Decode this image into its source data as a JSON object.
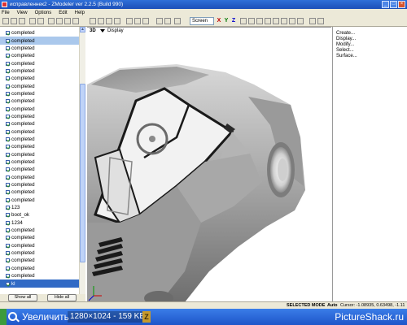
{
  "window": {
    "title": "исправленнек2 - ZModeler ver 2.2.5 (Build 990)"
  },
  "menu": [
    "File",
    "View",
    "Options",
    "Edit",
    "Help"
  ],
  "toolbar": {
    "snap_select": "Screen",
    "axes": [
      "X",
      "Y",
      "Z"
    ]
  },
  "sidebar": {
    "items": [
      {
        "label": "completed",
        "state": "normal"
      },
      {
        "label": "completed",
        "state": "selected"
      },
      {
        "label": "completed",
        "state": "normal"
      },
      {
        "label": "completed",
        "state": "normal"
      },
      {
        "label": "completed",
        "state": "normal"
      },
      {
        "label": "completed",
        "state": "normal"
      },
      {
        "label": "completed",
        "state": "normal"
      },
      {
        "label": "completed",
        "state": "normal"
      },
      {
        "label": "completed",
        "state": "normal"
      },
      {
        "label": "completed",
        "state": "normal"
      },
      {
        "label": "completed",
        "state": "normal"
      },
      {
        "label": "completed",
        "state": "normal"
      },
      {
        "label": "completed",
        "state": "normal"
      },
      {
        "label": "completed",
        "state": "normal"
      },
      {
        "label": "completed",
        "state": "normal"
      },
      {
        "label": "completed",
        "state": "normal"
      },
      {
        "label": "completed",
        "state": "normal"
      },
      {
        "label": "completed",
        "state": "normal"
      },
      {
        "label": "completed",
        "state": "normal"
      },
      {
        "label": "completed",
        "state": "normal"
      },
      {
        "label": "completed",
        "state": "normal"
      },
      {
        "label": "completed",
        "state": "normal"
      },
      {
        "label": "completed",
        "state": "normal"
      },
      {
        "label": "123",
        "state": "normal"
      },
      {
        "label": "boot_ok",
        "state": "normal"
      },
      {
        "label": "1234",
        "state": "normal"
      },
      {
        "label": "completed",
        "state": "normal"
      },
      {
        "label": "completed",
        "state": "normal"
      },
      {
        "label": "completed",
        "state": "normal"
      },
      {
        "label": "completed",
        "state": "normal"
      },
      {
        "label": "completed",
        "state": "normal"
      },
      {
        "label": "completed",
        "state": "normal"
      },
      {
        "label": "completed",
        "state": "normal"
      },
      {
        "label": "kl",
        "state": "active"
      }
    ],
    "show_all": "Show all",
    "hide_all": "Hide all"
  },
  "viewport": {
    "mode": "3D",
    "display": "Display"
  },
  "right_panel": [
    "Create...",
    "Display...",
    "Modify...",
    "Select...",
    "Surface..."
  ],
  "status": {
    "mode": "SELECTED MODE",
    "auto": "Auto",
    "cursor": "Cursor: -1.08935, 0.63498, -1.11"
  },
  "taskbar": {
    "label": "Увеличить",
    "size": "1280×1024 - 159 KB",
    "brand": "PictureShack.ru"
  },
  "colors": {
    "title": "#2458c8",
    "selection": "#316ac5",
    "chrome": "#ece9d8",
    "car_body": "#9e9e9e"
  }
}
